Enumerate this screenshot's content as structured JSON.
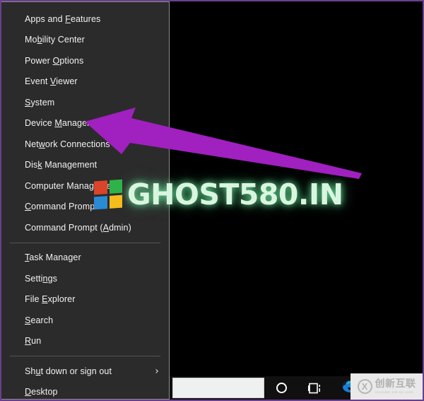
{
  "theme": {
    "menu_background": "#2b2b2b",
    "menu_border": "#8f8f8f",
    "desktop_background": "#000000",
    "screen_border": "#6b3f8f",
    "menu_text": "#f2f2f2",
    "separator": "#555555",
    "arrow_color": "#a020c0",
    "taskbar_background": "#101010",
    "search_box_background": "#eff0f0",
    "ghost_text_color": "#d9f5e0",
    "edge_blue": "#1b7fd4"
  },
  "winx_menu": {
    "name": "Power User Menu",
    "groups": [
      {
        "items": [
          {
            "label": "Apps and Features",
            "pre": "Apps and ",
            "accel": "F",
            "post": "eatures",
            "submenu": false
          },
          {
            "label": "Mobility Center",
            "pre": "Mo",
            "accel": "b",
            "post": "ility Center",
            "submenu": false
          },
          {
            "label": "Power Options",
            "pre": "Power ",
            "accel": "O",
            "post": "ptions",
            "submenu": false
          },
          {
            "label": "Event Viewer",
            "pre": "Event ",
            "accel": "V",
            "post": "iewer",
            "submenu": false
          },
          {
            "label": "System",
            "pre": "",
            "accel": "S",
            "post": "ystem",
            "submenu": false
          },
          {
            "label": "Device Manager",
            "pre": "Device ",
            "accel": "M",
            "post": "anager",
            "submenu": false
          },
          {
            "label": "Network Connections",
            "pre": "Net",
            "accel": "w",
            "post": "ork Connections",
            "submenu": false
          },
          {
            "label": "Disk Management",
            "pre": "Dis",
            "accel": "k",
            "post": " Management",
            "submenu": false
          },
          {
            "label": "Computer Management",
            "pre": "Computer Mana",
            "accel": "g",
            "post": "ement",
            "submenu": false
          },
          {
            "label": "Command Prompt",
            "pre": "",
            "accel": "C",
            "post": "ommand Prompt",
            "submenu": false
          },
          {
            "label": "Command Prompt (Admin)",
            "pre": "Command Prompt (",
            "accel": "A",
            "post": "dmin)",
            "submenu": false
          }
        ]
      },
      {
        "items": [
          {
            "label": "Task Manager",
            "pre": "",
            "accel": "T",
            "post": "ask Manager",
            "submenu": false
          },
          {
            "label": "Settings",
            "pre": "Setti",
            "accel": "n",
            "post": "gs",
            "submenu": false
          },
          {
            "label": "File Explorer",
            "pre": "File ",
            "accel": "E",
            "post": "xplorer",
            "submenu": false
          },
          {
            "label": "Search",
            "pre": "",
            "accel": "S",
            "post": "earch",
            "submenu": false
          },
          {
            "label": "Run",
            "pre": "",
            "accel": "R",
            "post": "un",
            "submenu": false
          }
        ]
      },
      {
        "items": [
          {
            "label": "Shut down or sign out",
            "pre": "Sh",
            "accel": "u",
            "post": "t down or sign out",
            "submenu": true,
            "chevron": "›"
          },
          {
            "label": "Desktop",
            "pre": "",
            "accel": "D",
            "post": "esktop",
            "submenu": false
          }
        ]
      }
    ]
  },
  "annotation": {
    "arrow": {
      "name": "purple-arrow",
      "color": "#a020c0",
      "points_to": "Device Manager",
      "direction": "left-up"
    }
  },
  "watermark_ghost": {
    "text": "GHOST580.IN",
    "logo_name": "windows-logo",
    "tile_colors": [
      "#d9442a",
      "#2eb34a",
      "#2a8ad4",
      "#f4bc1c"
    ]
  },
  "watermark_cx": {
    "chinese": "创新互联",
    "english": "CHUANG XIN HU LIAN",
    "logo_letter": "X"
  },
  "taskbar": {
    "search_placeholder": "",
    "search_value": "",
    "icons": [
      {
        "name": "cortana-icon",
        "label": "Cortana"
      },
      {
        "name": "task-view-icon",
        "label": "Task View"
      },
      {
        "name": "edge-icon",
        "label": "Microsoft Edge"
      }
    ]
  }
}
